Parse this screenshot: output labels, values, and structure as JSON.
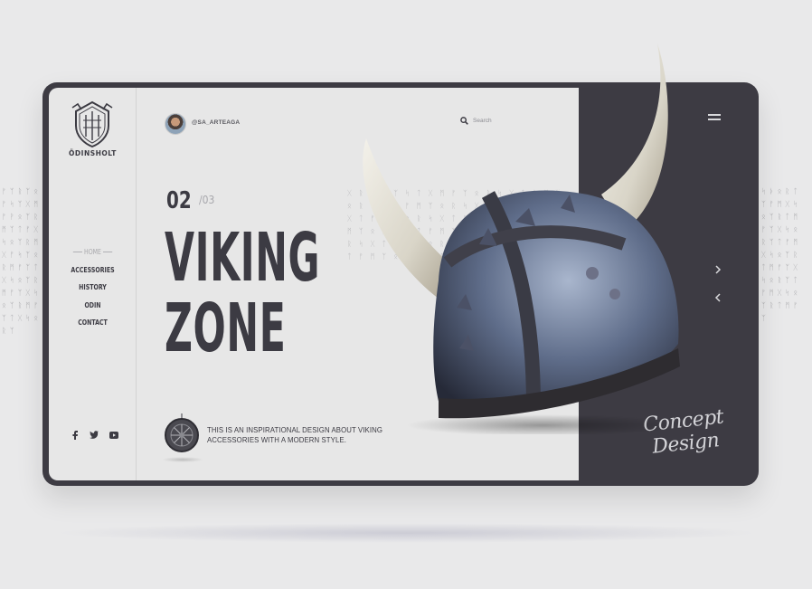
{
  "brand": {
    "name": "ÖDINSHOLT"
  },
  "nav": {
    "items": [
      {
        "label": "HOME",
        "active": true
      },
      {
        "label": "ACCESSORIES",
        "active": false
      },
      {
        "label": "HISTORY",
        "active": false
      },
      {
        "label": "ODIN",
        "active": false
      },
      {
        "label": "CONTACT",
        "active": false
      }
    ]
  },
  "header": {
    "handle": "@SA_ARTEAGA",
    "search_label": "Search"
  },
  "hero": {
    "slide_current": "02",
    "slide_total": "/03",
    "title_line1": "VIKING",
    "title_line2": "ZONE",
    "description": "THIS IS AN INSPIRATIONAL DESIGN ABOUT VIKING ACCESSORIES WITH A MODERN STYLE."
  },
  "right_panel": {
    "signature": "Concept Design"
  },
  "social": {
    "icons": [
      "facebook-icon",
      "twitter-icon",
      "youtube-icon"
    ]
  },
  "colors": {
    "background": "#e9e9ea",
    "panel": "#e7e7e7",
    "dark": "#3d3b43",
    "text": "#3c3b43",
    "muted": "#a7a7ab"
  }
}
